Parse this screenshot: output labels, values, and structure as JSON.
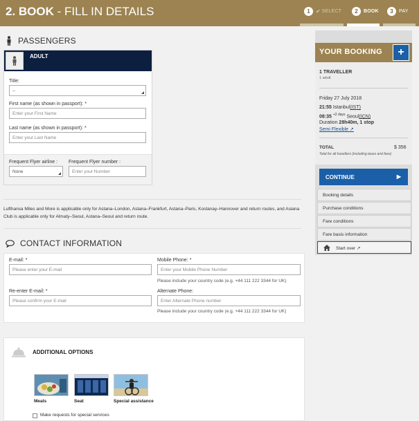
{
  "header": {
    "step_num": "2. BOOK",
    "step_rest": " - FILL IN DETAILS",
    "steps": [
      {
        "num": "1",
        "label": "SELECT"
      },
      {
        "num": "2",
        "label": "BOOK"
      },
      {
        "num": "3",
        "label": "PAY"
      }
    ]
  },
  "passengers": {
    "title": "PASSENGERS",
    "type_label": "ADULT",
    "title_label": "Title:",
    "title_value": "--",
    "first_name_label": "First name (as shown in passport): *",
    "first_name_placeholder": "Enter your First Name",
    "last_name_label": "Last name (as shown in passport): *",
    "last_name_placeholder": "Enter your Last Name",
    "ff_airline_label": "Frequent Flyer airline :",
    "ff_airline_value": "None",
    "ff_number_label": "Frequent Flyer number :",
    "ff_number_placeholder": "Enter your Number"
  },
  "note": "Lufthansa Miles and More is applicable only for Astana–London, Astana–Frankfurt, Astana–Paris, Kostanay–Hannover and return routes, and Asiana Club is applicable only for Almaty–Seoul, Astana–Seoul and return route.",
  "contact": {
    "title": "CONTACT INFORMATION",
    "email_label": "E-mail: *",
    "email_placeholder": "Please enter your E-mail",
    "reemail_label": "Re-enter E-mail: *",
    "reemail_placeholder": "Please confirm your E-mail",
    "mobile_label": "Mobile Phone: *",
    "mobile_placeholder": "Enter your Mobile Phone Number",
    "mobile_hint": "Please include your country code (e.g. +44 111 222 3344 for UK)",
    "alt_label": "Alternate Phone:",
    "alt_placeholder": "Enter Alternate Phone number",
    "alt_hint": "Please include your country code (e.g. +44 111 222 3344 for UK)"
  },
  "options": {
    "title": "ADDITIONAL OPTIONS",
    "items": [
      {
        "label": "Meals"
      },
      {
        "label": "Seat"
      },
      {
        "label": "Special assistance"
      }
    ],
    "special_requests": "Make requests for special services"
  },
  "booking": {
    "title": "YOUR BOOKING",
    "plus": "+",
    "travellers": "1 TRAVELLER",
    "adults": "1 adult",
    "date": "Friday 27 July 2018",
    "dep_time": "21:55",
    "dep_city": "Istanbul",
    "dep_code": "(IST)",
    "arr_time": "08:35",
    "arr_plus": "+2 days",
    "arr_city": "Seoul",
    "arr_code": "(ICN)",
    "duration_label": "Duration",
    "duration_value": "28h40m, 1 stop",
    "fare": "Semi Flexible",
    "total_label": "TOTAL",
    "total_value": "$ 356",
    "total_note": "Total for all travellers (including taxes and fees)",
    "continue": "CONTINUE",
    "links": [
      "Booking details",
      "Purchase conditions",
      "Fare conditions",
      "Fare basis information"
    ],
    "start_over": "Start over"
  },
  "colors": {
    "gold": "#9c8351",
    "navy": "#0c1f3f",
    "blue": "#1a5fa8"
  }
}
